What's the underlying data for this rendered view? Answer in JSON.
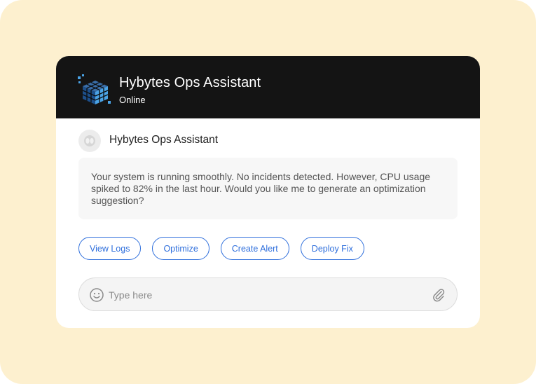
{
  "header": {
    "title": "Hybytes Ops Assistant",
    "status": "Online",
    "background_color": "#141414",
    "logo_icon": "rubiks-cube-icon"
  },
  "message": {
    "sender": "Hybytes Ops Assistant",
    "avatar_icon": "bot-avatar-icon",
    "text": "Your system is running smoothly. No incidents detected. However, CPU usage spiked to 82% in the last hour. Would you like me to generate an optimization suggestion?"
  },
  "quick_actions": [
    {
      "label": "View Logs"
    },
    {
      "label": "Optimize"
    },
    {
      "label": "Create Alert"
    },
    {
      "label": "Deploy Fix"
    }
  ],
  "composer": {
    "placeholder": "Type here",
    "emoji_icon": "smiley-icon",
    "attach_icon": "paperclip-icon"
  },
  "colors": {
    "page_background": "#fdf0cf",
    "accent": "#2f6fdc"
  }
}
